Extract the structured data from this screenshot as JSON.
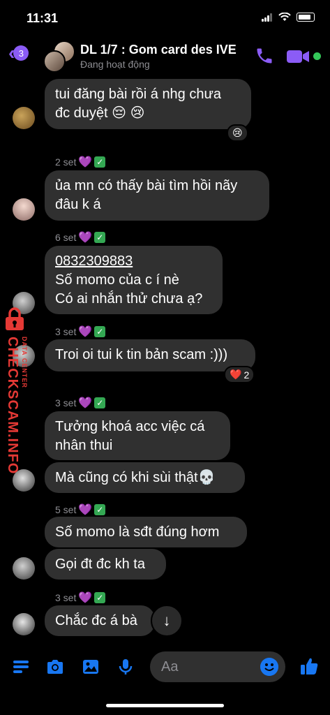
{
  "status_bar": {
    "time": "11:31"
  },
  "header": {
    "back_badge": "3",
    "title": "DL 1/7 : Gom card des IVE",
    "subtitle": "Đang hoạt động",
    "accent": "#8b5cf6"
  },
  "messages": [
    {
      "text1": "tui đăng bài rồi á nhg chưa",
      "text2": "đc duyệt 😔 😢",
      "reaction": "😢"
    },
    {
      "meta": "2 set",
      "text1": "ủa mn có thấy bài tìm hồi nãy",
      "text2": "đâu k á"
    },
    {
      "meta": "6 set",
      "text1": "0832309883",
      "text2": "Số momo của c í nè",
      "text3": "Có ai nhắn thử chưa ạ?"
    },
    {
      "meta": "3 set",
      "text1": "Troi oi tui k tin bản scam :)))",
      "reaction": "❤️",
      "reaction_count": "2"
    },
    {
      "meta": "3 set",
      "text1": "Tưởng khoá acc việc cá",
      "text2": "nhân thui"
    },
    {
      "text1": "Mà cũng có khi sùi thật💀"
    },
    {
      "meta": "5 set",
      "text1": "Số momo là sđt đúng hơm"
    },
    {
      "text1": "Gọi đt đc kh ta"
    },
    {
      "meta": "3 set",
      "text1": "Chắc đc á bà"
    }
  ],
  "meta_heart": "💜",
  "meta_check": "✓",
  "watermark": {
    "main": "CHECKSCAM.INFO",
    "small": "DATA CENTER"
  },
  "composer": {
    "placeholder": "Aa",
    "scroll_down": "↓"
  },
  "icons": [
    "menu-icon",
    "camera-icon",
    "gallery-icon",
    "mic-icon",
    "emoji-icon",
    "like-icon",
    "phone-icon",
    "video-icon"
  ]
}
